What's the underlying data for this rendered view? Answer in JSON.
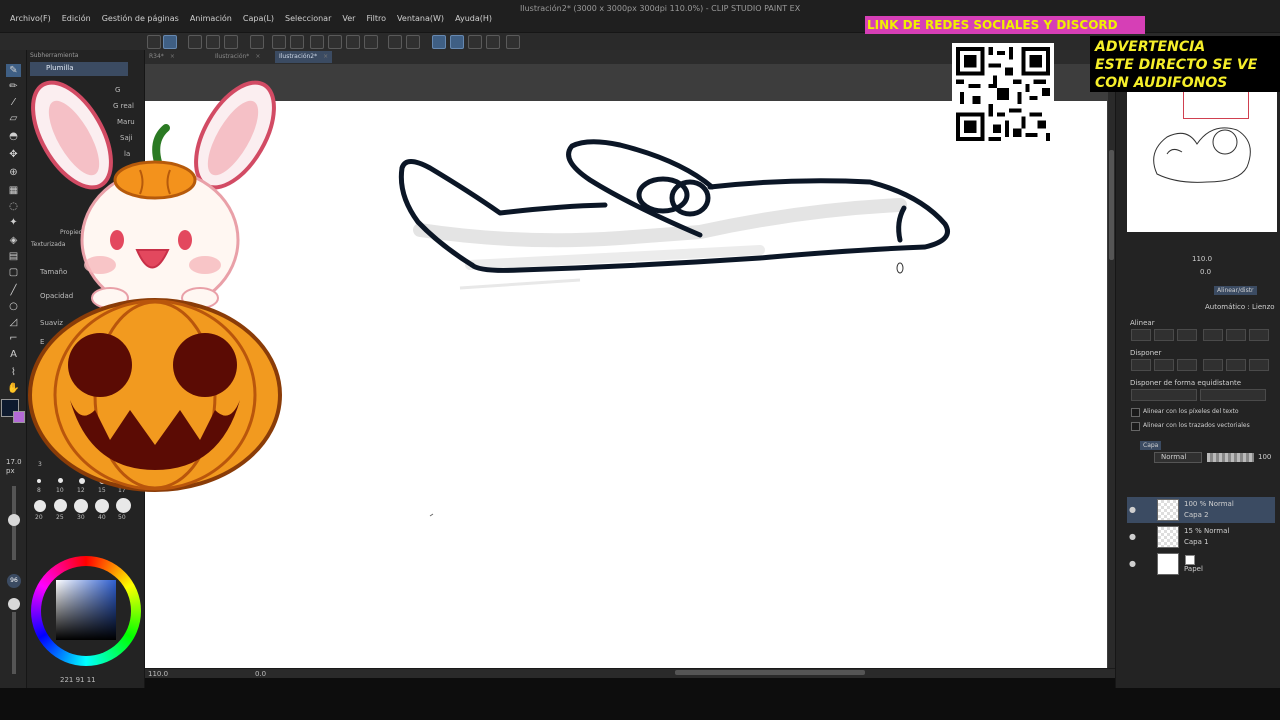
{
  "window_title": "Ilustración2* (3000 x 3000px 300dpi 110.0%)  - CLIP STUDIO PAINT EX",
  "menu": [
    "Archivo(F)",
    "Edición",
    "Gestión de páginas",
    "Animación",
    "Capa(L)",
    "Seleccionar",
    "Ver",
    "Filtro",
    "Ventana(W)",
    "Ayuda(H)"
  ],
  "doc_tabs": [
    {
      "label": "R34*",
      "active": false
    },
    {
      "label": "Ilustración*",
      "active": false
    },
    {
      "label": "Ilustración2*",
      "active": true
    }
  ],
  "subtool": {
    "header": "Subherramienta",
    "selected": "Plumilla",
    "brushes": [
      "G",
      "G real",
      "Maru",
      "Saji",
      "la"
    ],
    "properties_tab": "Propied",
    "texture_tab": "Texturizada",
    "props": [
      "Tamaño",
      "Opacidad",
      "Suaviz",
      "E"
    ],
    "size_value": "17.0",
    "size_unit": "px",
    "size_presets_row1": [
      "3"
    ],
    "size_presets_row2": [
      "8",
      "10",
      "12",
      "15",
      "17"
    ],
    "size_presets_row3": [
      "20",
      "25",
      "30",
      "40",
      "50"
    ],
    "slider_badge": "96"
  },
  "color": {
    "foreground": "#0e1a2e",
    "background": "#b36ad6",
    "status": "221  91  11"
  },
  "status_bar": {
    "zoom": "110.0",
    "rotation": "0.0"
  },
  "navigator": {
    "zoom": "110.0",
    "angle": "0.0"
  },
  "align_panel": {
    "tab": "Alinear/distr",
    "mode": "Automático : Lienzo",
    "align_label": "Alinear",
    "distribute_label": "Disponer",
    "equidistant_label": "Disponer de forma equidistante",
    "check_text_pixels": "Alinear con los píxeles del texto",
    "check_vector_paths": "Alinear con los trazados vectoriales"
  },
  "layer_panel": {
    "tab": "Capa",
    "blend_mode": "Normal",
    "opacity": "100",
    "layers": [
      {
        "mode": "100 % Normal",
        "name": "Capa 2",
        "active": true,
        "type": "raster"
      },
      {
        "mode": "15 % Normal",
        "name": "Capa 1",
        "active": false,
        "type": "raster"
      },
      {
        "mode": "",
        "name": "Papel",
        "active": false,
        "type": "paper"
      }
    ]
  },
  "overlays": {
    "social_banner": "LINK DE REDES SOCIALES Y DISCORD",
    "warning_lines": [
      "ADVERTENCIA",
      "ESTE DIRECTO SE VE",
      "CON  AUDIFONOS"
    ]
  },
  "icons": [
    "pen-icon",
    "eraser-icon",
    "fill-icon",
    "move-icon",
    "select-icon",
    "eyedropper-icon",
    "text-icon",
    "undo-icon",
    "redo-icon",
    "eye-icon",
    "qr-code"
  ]
}
